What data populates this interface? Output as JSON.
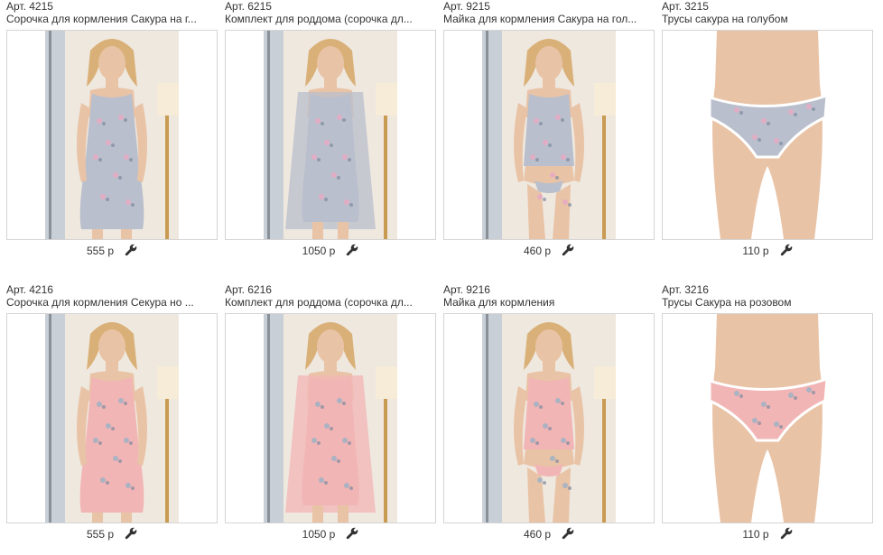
{
  "colors": {
    "border": "#d4d4d4",
    "text": "#333333",
    "grey_fabric": "#b9bfcc",
    "pink_fabric": "#f2b5b5",
    "room_wall": "#efe8df",
    "skin": "#e9c3a6"
  },
  "products": [
    {
      "art": "Арт. 4215",
      "title": "Сорочка для кормления Сакура на г...",
      "price": "555 р",
      "fabric": "grey",
      "kind": "nightgown",
      "action_icon": "wrench-icon"
    },
    {
      "art": "Арт. 6215",
      "title": "Комплект для роддома (сорочка дл...",
      "price": "1050 р",
      "fabric": "grey",
      "kind": "set",
      "action_icon": "wrench-icon"
    },
    {
      "art": "Арт. 9215",
      "title": "Майка для кормления Сакура на гол...",
      "price": "460 р",
      "fabric": "grey",
      "kind": "top",
      "action_icon": "wrench-icon"
    },
    {
      "art": "Арт. 3215",
      "title": "Трусы сакура на голубом",
      "price": "110 р",
      "fabric": "grey",
      "kind": "briefs",
      "action_icon": "wrench-icon"
    },
    {
      "art": "Арт. 4216",
      "title": "Сорочка для кормления Секура но ...",
      "price": "555 р",
      "fabric": "pink",
      "kind": "nightgown",
      "action_icon": "wrench-icon"
    },
    {
      "art": "Арт. 6216",
      "title": "Комплект для роддома (сорочка дл...",
      "price": "1050 р",
      "fabric": "pink",
      "kind": "set",
      "action_icon": "wrench-icon"
    },
    {
      "art": "Арт. 9216",
      "title": "Майка для кормления",
      "price": "460 р",
      "fabric": "pink",
      "kind": "top",
      "action_icon": "wrench-icon"
    },
    {
      "art": "Арт. 3216",
      "title": "Трусы Сакура на розовом",
      "price": "110 р",
      "fabric": "pink",
      "kind": "briefs",
      "action_icon": "wrench-icon"
    }
  ]
}
